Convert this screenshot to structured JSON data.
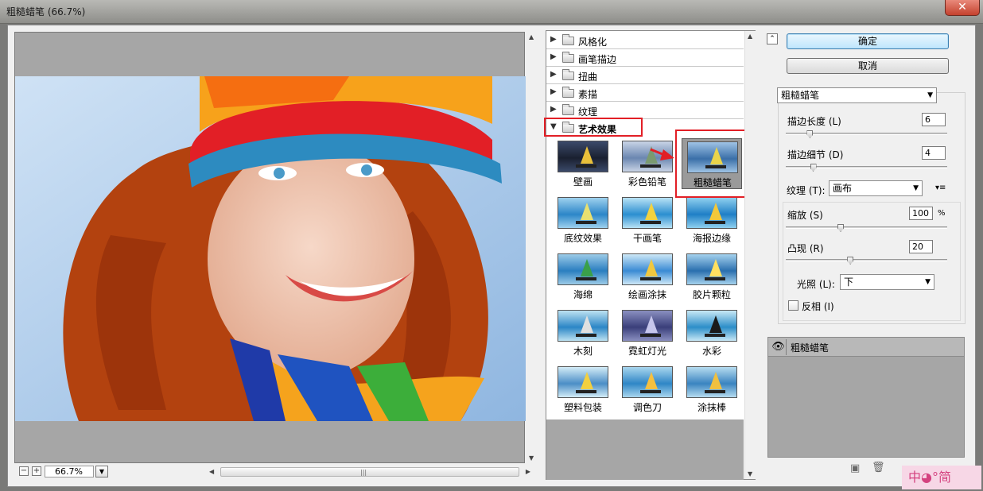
{
  "window": {
    "title": "粗糙蜡笔 (66.7%)",
    "close_glyph": "✕"
  },
  "preview": {
    "zoom": "66.7%",
    "zoom_minus": "−",
    "zoom_plus": "+",
    "scroll_grip": "|||"
  },
  "gallery": {
    "categories": [
      {
        "label": "风格化",
        "expanded": false
      },
      {
        "label": "画笔描边",
        "expanded": false
      },
      {
        "label": "扭曲",
        "expanded": false
      },
      {
        "label": "素描",
        "expanded": false
      },
      {
        "label": "纹理",
        "expanded": false
      },
      {
        "label": "艺术效果",
        "expanded": true
      }
    ],
    "filters": [
      {
        "label": "壁画",
        "selected": false
      },
      {
        "label": "彩色铅笔",
        "selected": false
      },
      {
        "label": "粗糙蜡笔",
        "selected": true
      },
      {
        "label": "底纹效果",
        "selected": false
      },
      {
        "label": "干画笔",
        "selected": false
      },
      {
        "label": "海报边缘",
        "selected": false
      },
      {
        "label": "海绵",
        "selected": false
      },
      {
        "label": "绘画涂抹",
        "selected": false
      },
      {
        "label": "胶片颗粒",
        "selected": false
      },
      {
        "label": "木刻",
        "selected": false
      },
      {
        "label": "霓虹灯光",
        "selected": false
      },
      {
        "label": "水彩",
        "selected": false
      },
      {
        "label": "塑料包装",
        "selected": false
      },
      {
        "label": "调色刀",
        "selected": false
      },
      {
        "label": "涂抹棒",
        "selected": false
      }
    ]
  },
  "buttons": {
    "ok": "确定",
    "cancel": "取消",
    "collapse_glyph": "⌃"
  },
  "settings": {
    "filter_select": "粗糙蜡笔",
    "stroke_length": {
      "label": "描边长度 (L)",
      "value": "6",
      "fraction": 0.15
    },
    "stroke_detail": {
      "label": "描边细节 (D)",
      "value": "4",
      "fraction": 0.17
    },
    "texture": {
      "label": "纹理 (T):",
      "value": "画布",
      "menu_glyph": "▾≡"
    },
    "scaling": {
      "label": "缩放 (S)",
      "value": "100",
      "unit": "%",
      "fraction": 0.34
    },
    "relief": {
      "label": "凸现 (R)",
      "value": "20",
      "fraction": 0.4
    },
    "light": {
      "label": "光照 (L):",
      "value": "下"
    },
    "invert": {
      "label": "反相 (I)",
      "checked": false
    }
  },
  "layers": {
    "items": [
      {
        "name": "粗糙蜡笔",
        "visible": true
      }
    ]
  },
  "watermark": "中◕°简"
}
